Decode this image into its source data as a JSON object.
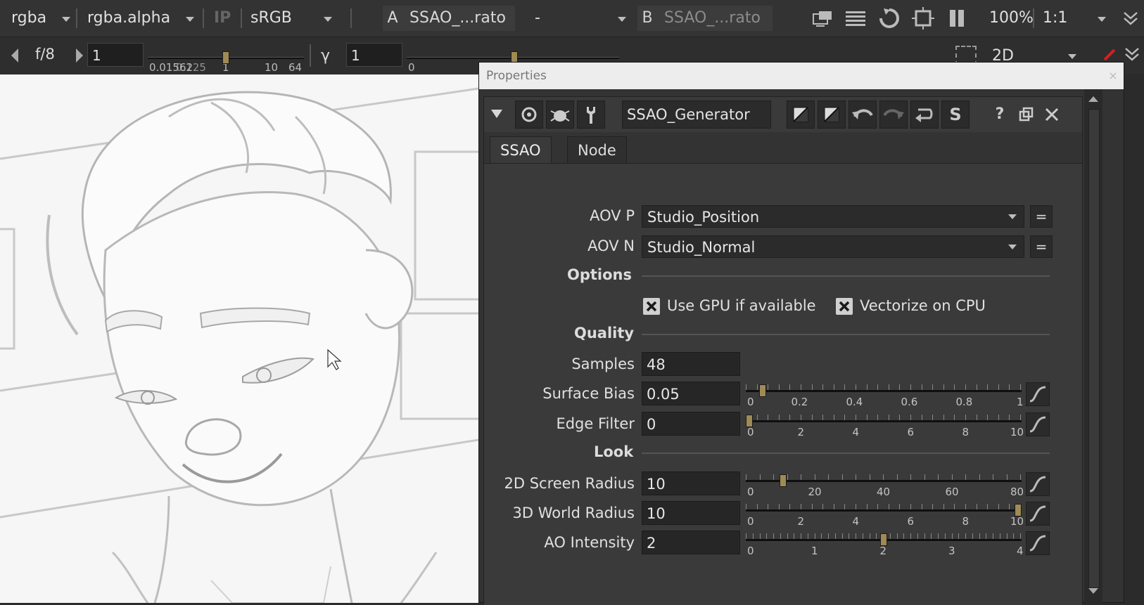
{
  "toolbar": {
    "channels": "rgba",
    "alpha_channel": "rgba.alpha",
    "ip": "IP",
    "colorspace": "sRGB",
    "input_a_letter": "A",
    "input_a": "SSAO_...rato",
    "operation": "-",
    "input_b_letter": "B",
    "input_b": "SSAO_...rato",
    "zoom": "100%",
    "ratio": "1:1"
  },
  "toolbar2": {
    "frame_label": "f/8",
    "gain_value": "1",
    "gain_ticks": [
      "0.01562",
      "0.125",
      "1",
      "10",
      "64"
    ],
    "gamma_label": "γ",
    "gamma_value": "1",
    "gamma_ticks": [
      "0"
    ],
    "view_mode": "2D"
  },
  "panel": {
    "title": "Properties",
    "node_name": "SSAO_Generator",
    "tabs": [
      "SSAO",
      "Node"
    ],
    "aov_p_label": "AOV P",
    "aov_p_value": "Studio_Position",
    "aov_n_label": "AOV N",
    "aov_n_value": "Studio_Normal",
    "eq": "=",
    "section_options": "Options",
    "gpu_label": "Use GPU if available",
    "gpu_checked": true,
    "vectorize_label": "Vectorize on CPU",
    "vectorize_checked": true,
    "section_quality": "Quality",
    "samples_label": "Samples",
    "samples_value": "48",
    "surface_bias_label": "Surface Bias",
    "surface_bias_value": "0.05",
    "surface_bias_ticks": [
      "0",
      "0.2",
      "0.4",
      "0.6",
      "0.8",
      "1"
    ],
    "edge_filter_label": "Edge Filter",
    "edge_filter_value": "0",
    "edge_filter_ticks": [
      "0",
      "2",
      "4",
      "6",
      "8",
      "10"
    ],
    "section_look": "Look",
    "screen_radius_label": "2D Screen Radius",
    "screen_radius_value": "10",
    "screen_radius_ticks": [
      "0",
      "20",
      "40",
      "60",
      "80"
    ],
    "world_radius_label": "3D World Radius",
    "world_radius_value": "10",
    "world_radius_ticks": [
      "0",
      "2",
      "4",
      "6",
      "8",
      "10"
    ],
    "ao_intensity_label": "AO Intensity",
    "ao_intensity_value": "2",
    "ao_intensity_ticks": [
      "0",
      "1",
      "2",
      "3",
      "4"
    ]
  },
  "colors": {
    "handle": "#a08a55",
    "panel_bg": "#3a3a3a",
    "viewer_bg": "#f7f7f7"
  }
}
